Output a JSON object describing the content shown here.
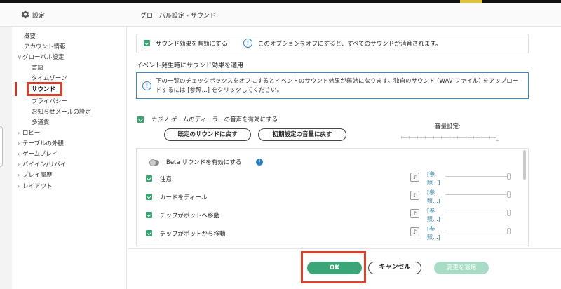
{
  "header": {
    "app_title": "設定",
    "page_title": "グローバル設定 - サウンド"
  },
  "sidebar": {
    "items": [
      {
        "label": "概要"
      },
      {
        "label": "アカウント情報"
      },
      {
        "label": "グローバル設定",
        "chevron": "∨"
      },
      {
        "label": "言語"
      },
      {
        "label": "タイムゾーン"
      },
      {
        "label": "サウンド"
      },
      {
        "label": "プライバシー"
      },
      {
        "label": "お知らせメールの設定"
      },
      {
        "label": "多通貨"
      },
      {
        "label": "ロビー",
        "chevron": "›"
      },
      {
        "label": "テーブルの外観",
        "chevron": "›"
      },
      {
        "label": "ゲームプレイ",
        "chevron": "›"
      },
      {
        "label": "バイイン/リバイ",
        "chevron": "›"
      },
      {
        "label": "プレイ履歴",
        "chevron": "›"
      },
      {
        "label": "レイアウト",
        "chevron": "›"
      }
    ]
  },
  "main": {
    "enable_sound_label": "サウンド効果を有効にする",
    "enable_sound_note": "このオプションをオフにすると、すべてのサウンドが消音されます。",
    "section_title": "イベント発生時にサウンド効果を適用",
    "info_text": "下の一覧のチェックボックスをオフにするとイベントのサウンド効果が無効になります。独自のサウンド (WAV ファイル) をアップロードするには [参照...] をクリックしてください。",
    "casino_dealer_label": "カジノ ゲームのディーラーの音声を有効にする",
    "restore_default_sound": "既定のサウンドに戻す",
    "restore_default_volume": "初期設定の音量に戻す",
    "volume_label": "音量設定:",
    "beta_label": "Beta サウンドを有効にする",
    "browse_label": "[参照...]",
    "rows": [
      {
        "label": "注意"
      },
      {
        "label": "カードをディール"
      },
      {
        "label": "チップがポットへ移動"
      },
      {
        "label": "チップがポットから移動"
      }
    ]
  },
  "footer": {
    "ok": "OK",
    "cancel": "キャンセル",
    "apply": "変更を適用"
  },
  "colors": {
    "accent_green": "#36a371",
    "highlight_red": "#d9412c",
    "info_blue": "#2a7fc0"
  }
}
